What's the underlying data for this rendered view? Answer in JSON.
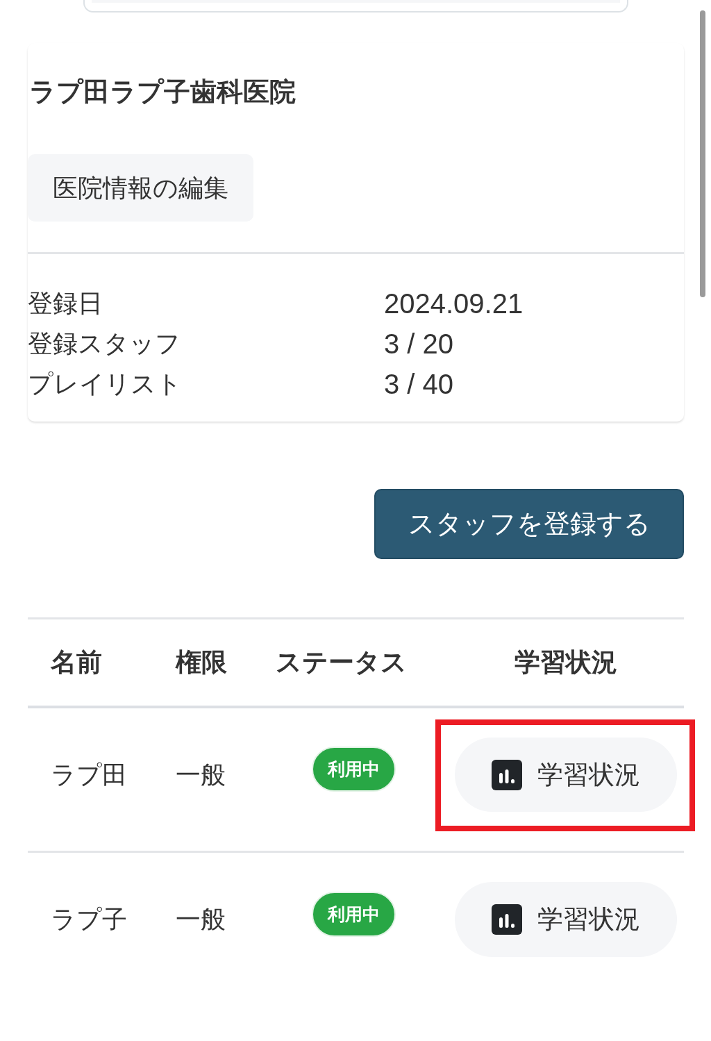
{
  "clinic": {
    "name": "ラプ田ラプ子歯科医院",
    "edit_button": "医院情報の編集",
    "info": [
      {
        "label": "登録日",
        "value": "2024.09.21"
      },
      {
        "label": "登録スタッフ",
        "value": "3 / 20"
      },
      {
        "label": "プレイリスト",
        "value": "3 / 40"
      }
    ]
  },
  "register_button": "スタッフを登録する",
  "staff_table": {
    "columns": [
      "名前",
      "権限",
      "ステータス",
      "学習状況"
    ],
    "rows": [
      {
        "name": "ラプ田",
        "role": "一般",
        "status": "利用中",
        "action": "学習状況",
        "highlighted": true
      },
      {
        "name": "ラプ子",
        "role": "一般",
        "status": "利用中",
        "action": "学習状況",
        "highlighted": false
      }
    ]
  }
}
